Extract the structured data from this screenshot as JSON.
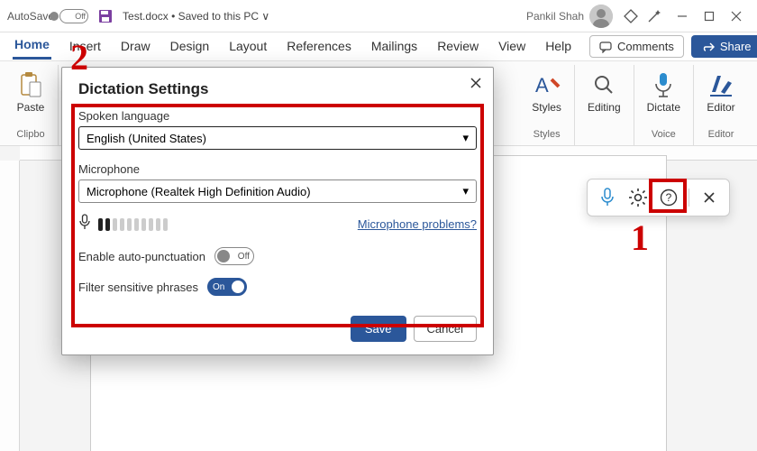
{
  "titlebar": {
    "autosave_label": "AutoSave",
    "autosave_state": "Off",
    "doc_title": "Test.docx • Saved to this PC ∨",
    "username": "Pankil Shah"
  },
  "tabs": {
    "items": [
      "Home",
      "Insert",
      "Draw",
      "Design",
      "Layout",
      "References",
      "Mailings",
      "Review",
      "View",
      "Help"
    ],
    "active": "Home",
    "comments_label": "Comments",
    "share_label": "Share"
  },
  "ribbon": {
    "clipboard": {
      "paste": "Paste",
      "group": "Clipbo"
    },
    "styles": {
      "btn": "Styles",
      "group": "Styles"
    },
    "editing": {
      "btn": "Editing"
    },
    "voice": {
      "btn": "Dictate",
      "group": "Voice"
    },
    "editor": {
      "btn": "Editor",
      "group": "Editor"
    }
  },
  "dialog": {
    "title": "Dictation Settings",
    "lang_label": "Spoken language",
    "lang_value": "English (United States)",
    "mic_label": "Microphone",
    "mic_value": "Microphone (Realtek High Definition Audio)",
    "mic_problems": "Microphone problems?",
    "autopunct_label": "Enable auto-punctuation",
    "autopunct_state": "Off",
    "filter_label": "Filter sensitive phrases",
    "filter_state": "On",
    "save": "Save",
    "cancel": "Cancel"
  },
  "callouts": {
    "one": "1",
    "two": "2"
  }
}
